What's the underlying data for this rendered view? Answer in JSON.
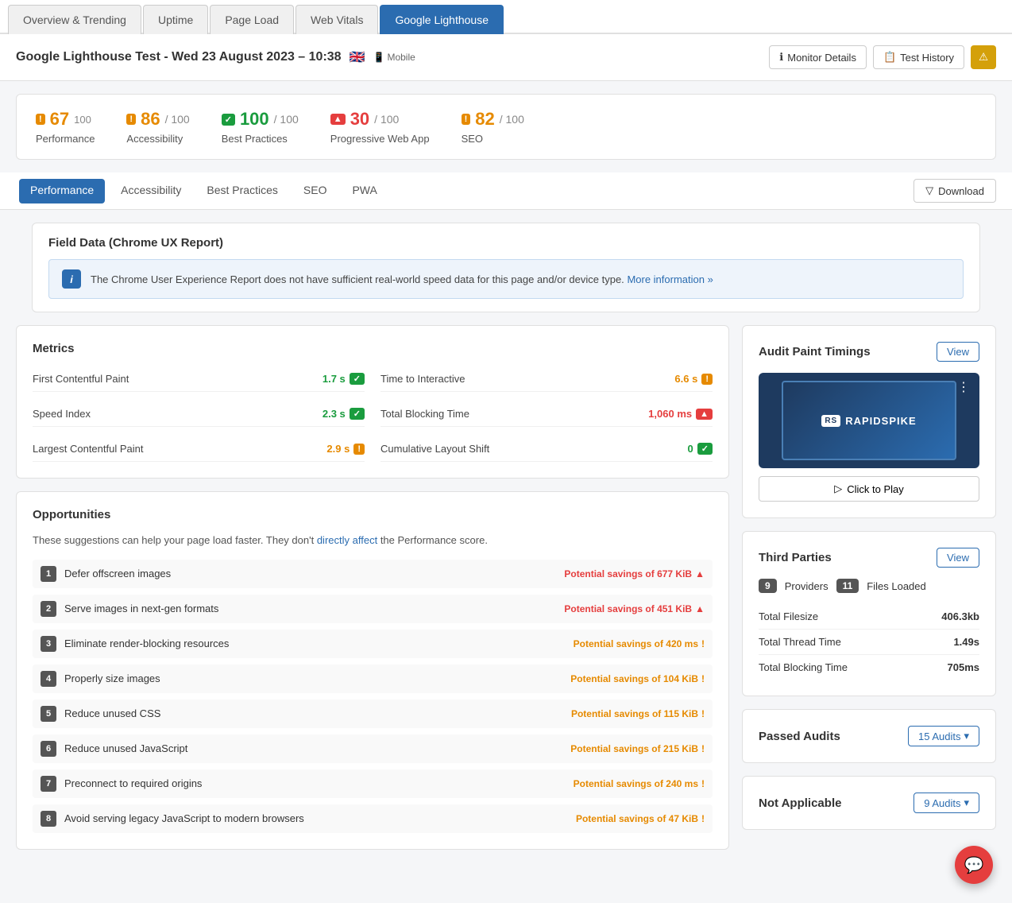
{
  "nav": {
    "tabs": [
      {
        "label": "Overview & Trending",
        "active": false
      },
      {
        "label": "Uptime",
        "active": false
      },
      {
        "label": "Page Load",
        "active": false
      },
      {
        "label": "Web Vitals",
        "active": false
      },
      {
        "label": "Google Lighthouse",
        "active": true
      }
    ]
  },
  "header": {
    "title": "Google Lighthouse Test - Wed 23 August 2023 – 10:38",
    "flag": "🇬🇧",
    "device": "Mobile",
    "monitor_details": "Monitor Details",
    "test_history": "Test History"
  },
  "scores": [
    {
      "label": "Performance",
      "value": "67",
      "max": "100",
      "type": "warn"
    },
    {
      "label": "Accessibility",
      "value": "86",
      "max": "100",
      "type": "warn"
    },
    {
      "label": "Best Practices",
      "value": "100",
      "max": "100",
      "type": "good"
    },
    {
      "label": "Progressive Web App",
      "value": "30",
      "max": "100",
      "type": "danger"
    },
    {
      "label": "SEO",
      "value": "82",
      "max": "100",
      "type": "warn"
    }
  ],
  "sub_tabs": {
    "tabs": [
      {
        "label": "Performance",
        "active": true
      },
      {
        "label": "Accessibility",
        "active": false
      },
      {
        "label": "Best Practices",
        "active": false
      },
      {
        "label": "SEO",
        "active": false
      },
      {
        "label": "PWA",
        "active": false
      }
    ],
    "download_label": "Download"
  },
  "field_data": {
    "title": "Field Data (Chrome UX Report)",
    "info_text": "The Chrome User Experience Report does not have sufficient real-world speed data for this page and/or device type.",
    "info_link": "More information »"
  },
  "metrics": {
    "title": "Metrics",
    "items": [
      {
        "name": "First Contentful Paint",
        "value": "1.7 s",
        "type": "good"
      },
      {
        "name": "Time to Interactive",
        "value": "6.6 s",
        "type": "warn"
      },
      {
        "name": "Speed Index",
        "value": "2.3 s",
        "type": "good"
      },
      {
        "name": "Total Blocking Time",
        "value": "1,060 ms",
        "type": "danger"
      },
      {
        "name": "Largest Contentful Paint",
        "value": "2.9 s",
        "type": "warn"
      },
      {
        "name": "Cumulative Layout Shift",
        "value": "0",
        "type": "good"
      }
    ]
  },
  "opportunities": {
    "title": "Opportunities",
    "intro": "These suggestions can help your page load faster. They don't",
    "intro_link_text": "directly affect",
    "intro_end": "the Performance score.",
    "items": [
      {
        "num": 1,
        "label": "Defer offscreen images",
        "savings": "Potential savings of 677 KiB",
        "type": "danger"
      },
      {
        "num": 2,
        "label": "Serve images in next-gen formats",
        "savings": "Potential savings of 451 KiB",
        "type": "danger"
      },
      {
        "num": 3,
        "label": "Eliminate render-blocking resources",
        "savings": "Potential savings of 420 ms",
        "type": "warn"
      },
      {
        "num": 4,
        "label": "Properly size images",
        "savings": "Potential savings of 104 KiB",
        "type": "warn"
      },
      {
        "num": 5,
        "label": "Reduce unused CSS",
        "savings": "Potential savings of 115 KiB",
        "type": "warn"
      },
      {
        "num": 6,
        "label": "Reduce unused JavaScript",
        "savings": "Potential savings of 215 KiB",
        "type": "warn"
      },
      {
        "num": 7,
        "label": "Preconnect to required origins",
        "savings": "Potential savings of 240 ms",
        "type": "warn"
      },
      {
        "num": 8,
        "label": "Avoid serving legacy JavaScript to modern browsers",
        "savings": "Potential savings of 47 KiB",
        "type": "warn"
      }
    ]
  },
  "audit_paint": {
    "title": "Audit Paint Timings",
    "view_label": "View",
    "logo_text": "RAPIDSPIKE",
    "play_label": "Click to Play"
  },
  "third_parties": {
    "title": "Third Parties",
    "view_label": "View",
    "providers_count": "9",
    "providers_label": "Providers",
    "files_count": "11",
    "files_label": "Files Loaded",
    "rows": [
      {
        "label": "Total Filesize",
        "value": "406.3kb"
      },
      {
        "label": "Total Thread Time",
        "value": "1.49s"
      },
      {
        "label": "Total Blocking Time",
        "value": "705ms"
      }
    ]
  },
  "passed_audits": {
    "title": "Passed Audits",
    "count_label": "15 Audits",
    "expand_icon": "▾"
  },
  "not_applicable": {
    "title": "Not Applicable",
    "count_label": "9 Audits",
    "expand_icon": "▾"
  }
}
